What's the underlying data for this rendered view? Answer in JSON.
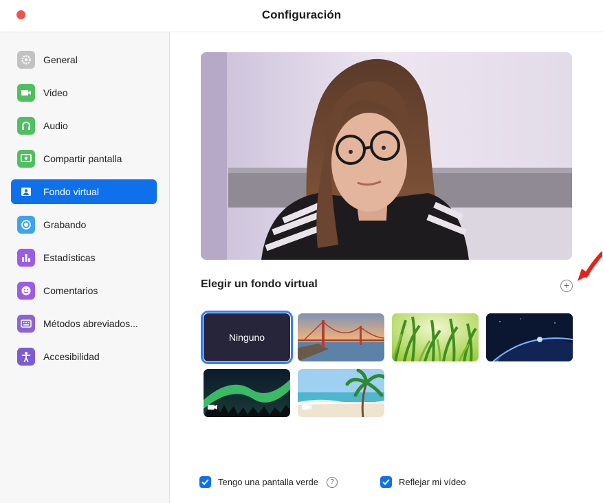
{
  "window": {
    "title": "Configuración"
  },
  "sidebar": {
    "items": [
      {
        "label": "General",
        "icon": "gear-icon",
        "color": "#b9b9b9"
      },
      {
        "label": "Video",
        "icon": "video-camera-icon",
        "color": "#4fbf5f"
      },
      {
        "label": "Audio",
        "icon": "headphones-icon",
        "color": "#4fbf5f"
      },
      {
        "label": "Compartir pantalla",
        "icon": "share-screen-icon",
        "color": "#4fbf5f"
      },
      {
        "label": "Fondo virtual",
        "icon": "portrait-icon",
        "color": "#0e71eb",
        "active": true
      },
      {
        "label": "Grabando",
        "icon": "record-icon",
        "color": "#3aa3f2"
      },
      {
        "label": "Estadísticas",
        "icon": "bar-chart-icon",
        "color": "#9b5de5"
      },
      {
        "label": "Comentarios",
        "icon": "smiley-icon",
        "color": "#9b5de5"
      },
      {
        "label": "Métodos abreviados...",
        "icon": "keyboard-icon",
        "color": "#8a64d6"
      },
      {
        "label": "Accesibilidad",
        "icon": "accessibility-icon",
        "color": "#7d5bd1"
      }
    ]
  },
  "main": {
    "section_title": "Elegir un fondo virtual",
    "add_icon": "plus-circle-icon",
    "backgrounds": [
      {
        "label": "Ninguno",
        "selected": true
      },
      {
        "name": "golden-gate-bridge"
      },
      {
        "name": "grass"
      },
      {
        "name": "earth-from-space"
      },
      {
        "name": "aurora",
        "video": true
      },
      {
        "name": "beach",
        "video": true
      }
    ],
    "green_screen": {
      "label": "Tengo una pantalla verde",
      "checked": true,
      "help_icon": "question-circle-icon"
    },
    "mirror_video": {
      "label": "Reflejar mi vídeo",
      "checked": true
    }
  },
  "colors": {
    "accent": "#0e71eb",
    "close": "#f2504b",
    "annotation_arrow": "#e8201a"
  }
}
